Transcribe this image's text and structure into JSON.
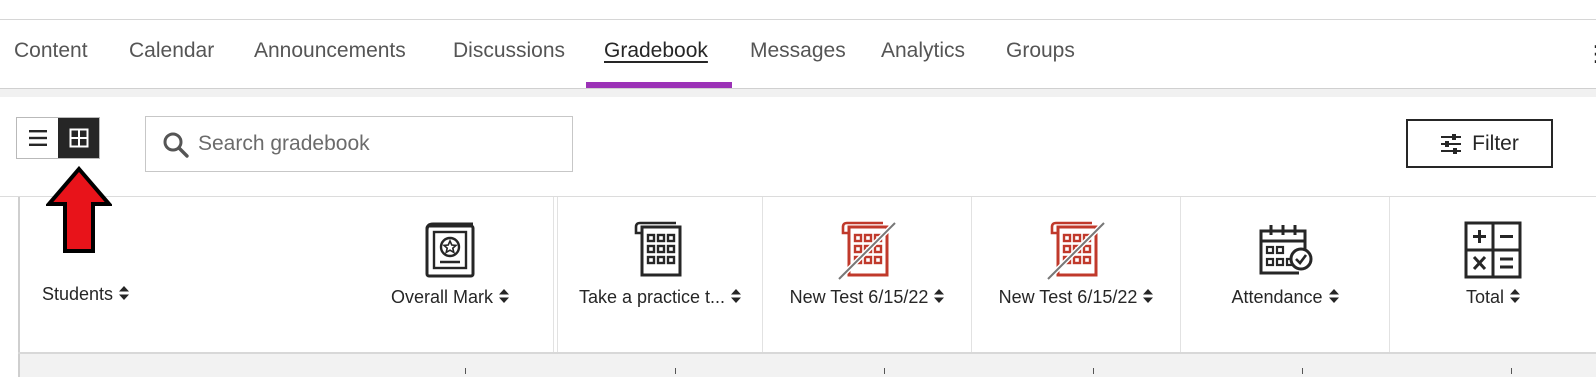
{
  "tabs": [
    {
      "label": "Content"
    },
    {
      "label": "Calendar"
    },
    {
      "label": "Announcements"
    },
    {
      "label": "Discussions"
    },
    {
      "label": "Gradebook",
      "active": true
    },
    {
      "label": "Messages"
    },
    {
      "label": "Analytics"
    },
    {
      "label": "Groups"
    }
  ],
  "toolbar": {
    "view_toggle": {
      "list_icon": "list-view-icon",
      "grid_icon": "grid-view-icon",
      "active": "grid"
    },
    "search": {
      "placeholder": "Search gradebook",
      "value": "",
      "icon": "search-icon"
    },
    "filter": {
      "label": "Filter",
      "icon": "sliders-icon"
    }
  },
  "annotation": {
    "icon": "red-arrow-up-icon",
    "color": "#e8131a"
  },
  "grid": {
    "students_header": "Students",
    "columns": [
      {
        "label": "Overall Mark",
        "icon": "overall-mark-icon",
        "color": "#262626"
      },
      {
        "label": "Take a practice t...",
        "icon": "test-icon",
        "color": "#262626"
      },
      {
        "label": "New Test 6/15/22",
        "icon": "hidden-test-icon",
        "color": "#c0392b"
      },
      {
        "label": "New Test 6/15/22",
        "icon": "hidden-test-icon",
        "color": "#c0392b"
      },
      {
        "label": "Attendance",
        "icon": "attendance-calendar-icon",
        "color": "#262626"
      },
      {
        "label": "Total",
        "icon": "calculator-icon",
        "color": "#262626"
      }
    ]
  },
  "colors": {
    "accent": "#9b32b6",
    "dark": "#262626",
    "hidden_item": "#c0392b"
  }
}
